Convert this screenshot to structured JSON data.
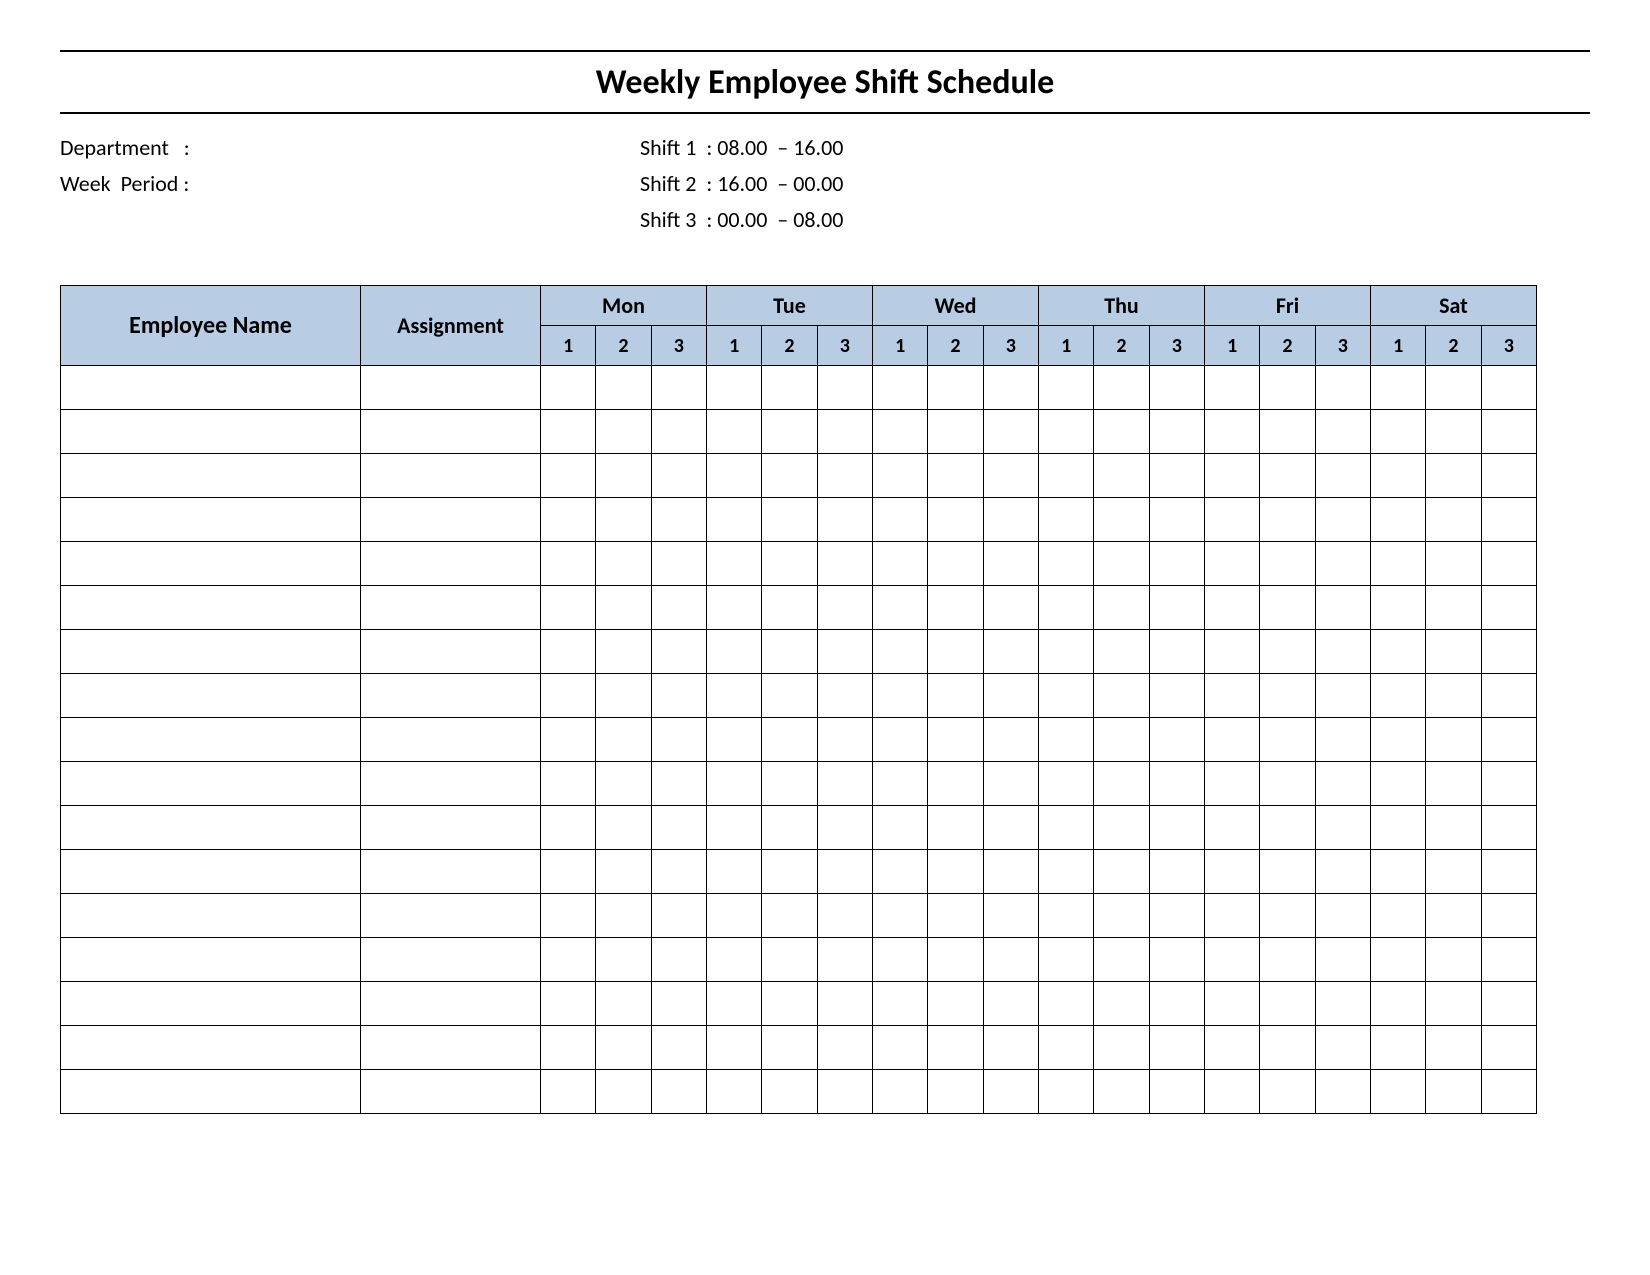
{
  "title": "Weekly Employee Shift Schedule",
  "info": {
    "left": [
      "Department   :",
      "Week  Period :"
    ],
    "right": [
      "Shift 1  : 08.00  – 16.00",
      "Shift 2  : 16.00  – 00.00",
      "Shift 3  : 00.00  – 08.00"
    ]
  },
  "table": {
    "headers": {
      "name": "Employee Name",
      "assignment": "Assignment",
      "days": [
        "Mon",
        "Tue",
        "Wed",
        "Thu",
        "Fri",
        "Sat"
      ],
      "shifts": [
        "1",
        "2",
        "3"
      ]
    },
    "row_count": 17
  }
}
